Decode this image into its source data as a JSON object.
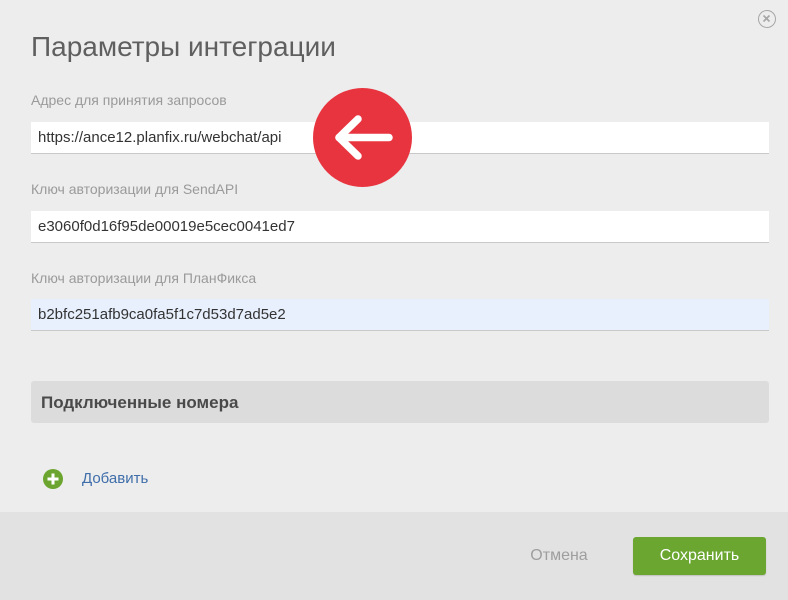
{
  "dialog": {
    "title": "Параметры интеграции",
    "close_icon": "close-circle-icon"
  },
  "fields": {
    "request_address": {
      "label": "Адрес для принятия запросов",
      "value": "https://ance12.planfix.ru/webchat/api"
    },
    "sendapi_key": {
      "label": "Ключ авторизации для SendAPI",
      "value": "e3060f0d16f95de00019e5cec0041ed7"
    },
    "planfix_key": {
      "label": "Ключ авторизации для ПланФикса",
      "value": "b2bfc251afb9ca0fa5f1c7d53d7ad5e2"
    }
  },
  "annotation": {
    "icon": "arrow-left-icon",
    "color": "#e8343f"
  },
  "connected_numbers": {
    "header": "Подключенные номера",
    "add_label": "Добавить",
    "add_icon": "plus-circle-icon"
  },
  "footer": {
    "cancel_label": "Отмена",
    "save_label": "Сохранить"
  },
  "colors": {
    "accent_green": "#6aa630",
    "link_blue": "#3f6eaa",
    "annotation_red": "#e8343f"
  }
}
